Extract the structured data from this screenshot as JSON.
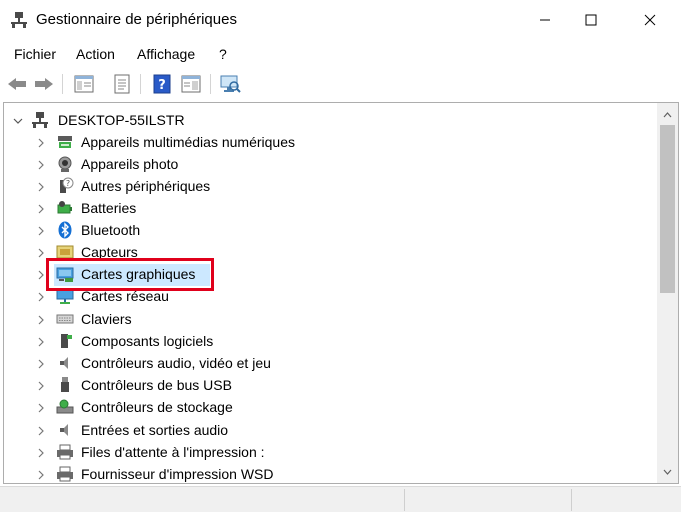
{
  "window": {
    "title": "Gestionnaire de périphériques",
    "app_icon": "device-manager-icon",
    "controls": [
      "minimize-icon",
      "maximize-icon",
      "close-icon"
    ]
  },
  "menu": {
    "items": [
      "Fichier",
      "Action",
      "Affichage",
      "?"
    ]
  },
  "toolbar": {
    "buttons": [
      "back-arrow-icon",
      "forward-arrow-icon",
      "properties-pane-icon",
      "properties-icon",
      "help-icon",
      "view-pane-icon",
      "scan-hardware-icon"
    ]
  },
  "tree": {
    "root": "DESKTOP-55ILSTR",
    "selected": "Cartes graphiques",
    "items": [
      {
        "label": "Appareils multimédias numériques",
        "icon": "multimedia-device-icon"
      },
      {
        "label": "Appareils photo",
        "icon": "camera-icon"
      },
      {
        "label": "Autres périphériques",
        "icon": "unknown-device-icon"
      },
      {
        "label": "Batteries",
        "icon": "battery-icon"
      },
      {
        "label": "Bluetooth",
        "icon": "bluetooth-icon"
      },
      {
        "label": "Capteurs",
        "icon": "sensor-icon"
      },
      {
        "label": "Cartes graphiques",
        "icon": "display-adapter-icon"
      },
      {
        "label": "Cartes réseau",
        "icon": "network-adapter-icon"
      },
      {
        "label": "Claviers",
        "icon": "keyboard-icon"
      },
      {
        "label": "Composants logiciels",
        "icon": "software-component-icon"
      },
      {
        "label": "Contrôleurs audio, vidéo et jeu",
        "icon": "audio-controller-icon"
      },
      {
        "label": "Contrôleurs de bus USB",
        "icon": "usb-icon"
      },
      {
        "label": "Contrôleurs de stockage",
        "icon": "storage-controller-icon"
      },
      {
        "label": "Entrées et sorties audio",
        "icon": "audio-io-icon"
      },
      {
        "label": "Files d'attente à l'impression :",
        "icon": "print-queue-icon"
      },
      {
        "label": "Fournisseur d'impression WSD",
        "icon": "printer-icon"
      }
    ]
  },
  "colors": {
    "selection": "#cce8ff",
    "highlight_box": "#e0001b",
    "scrollbar_thumb": "#c1c1c1"
  }
}
